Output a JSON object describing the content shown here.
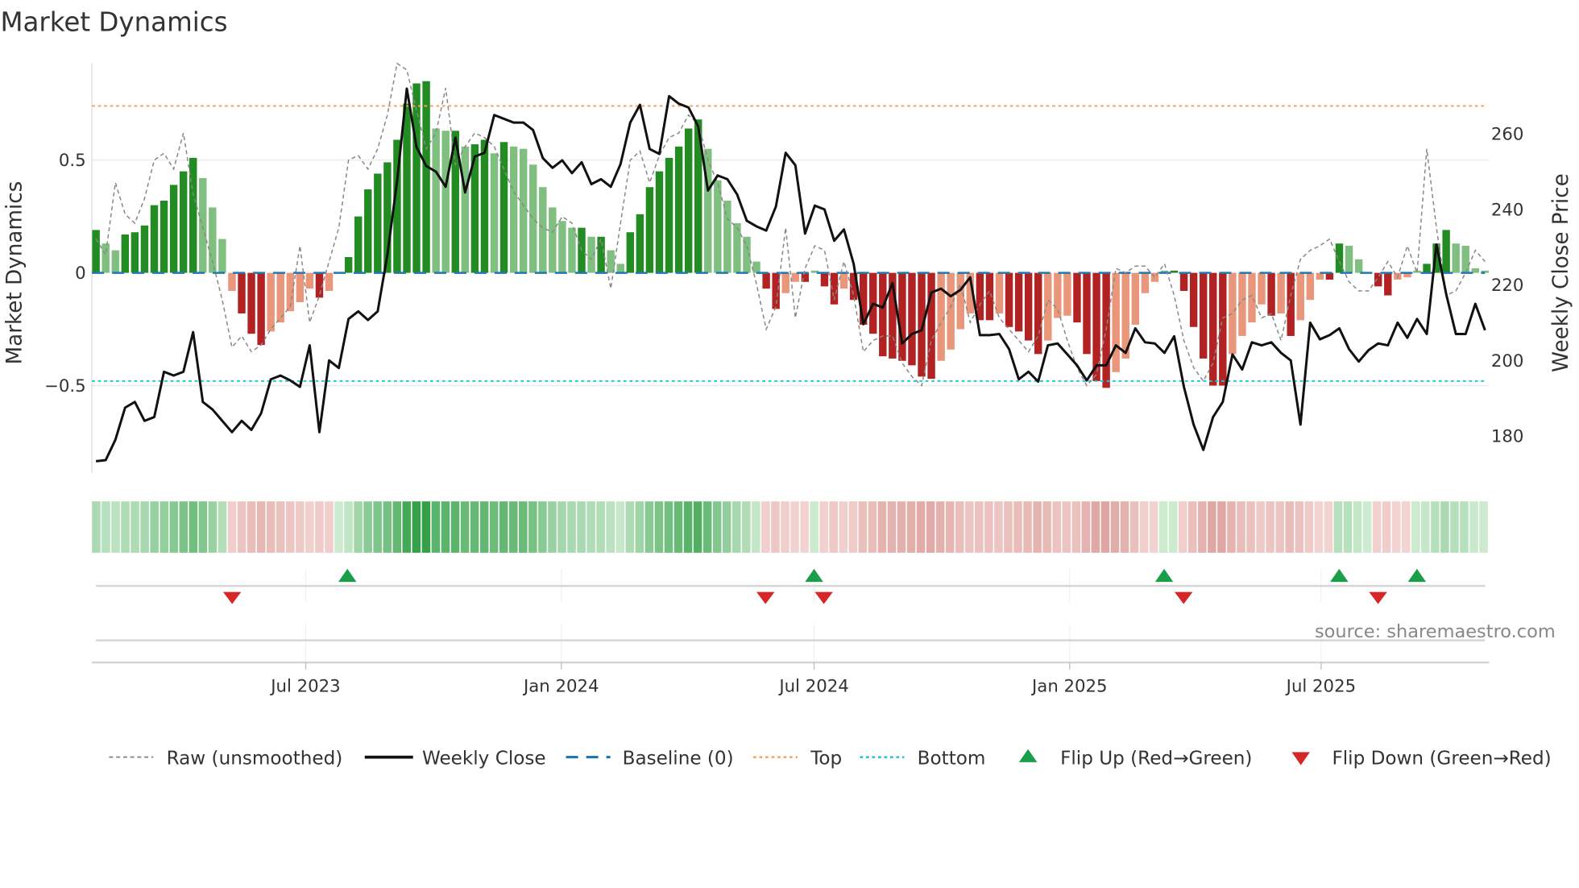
{
  "chart_data": {
    "type": "bar",
    "title": "Market Dynamics",
    "ylabel_left": "Market Dynamics",
    "ylabel_right": "Weekly Close Price",
    "ylim_left": [
      -0.92,
      0.92
    ],
    "ylim_right": [
      166,
      282
    ],
    "left_ticks": [
      {
        "v": 0.5,
        "label": "0.5"
      },
      {
        "v": 0,
        "label": "0"
      },
      {
        "v": -0.5,
        "label": "−0.5"
      }
    ],
    "right_ticks": [
      {
        "v": 260,
        "label": "260"
      },
      {
        "v": 240,
        "label": "240"
      },
      {
        "v": 220,
        "label": "220"
      },
      {
        "v": 200,
        "label": "200"
      },
      {
        "v": 180,
        "label": "180"
      }
    ],
    "x_start": "2023-01-31",
    "x_end": "2025-10-27",
    "x_ticks": [
      {
        "date": "2023-07-01",
        "label": "Jul 2023"
      },
      {
        "date": "2024-01-01",
        "label": "Jan 2024"
      },
      {
        "date": "2024-07-01",
        "label": "Jul 2024"
      },
      {
        "date": "2025-01-01",
        "label": "Jan 2025"
      },
      {
        "date": "2025-07-01",
        "label": "Jul 2025"
      }
    ],
    "top_level": 0.74,
    "bottom_level": -0.48,
    "baseline": 0,
    "momentum": [
      0.19,
      0.13,
      0.1,
      0.17,
      0.18,
      0.21,
      0.3,
      0.32,
      0.39,
      0.45,
      0.51,
      0.42,
      0.29,
      0.15,
      -0.08,
      -0.18,
      -0.27,
      -0.32,
      -0.26,
      -0.22,
      -0.17,
      -0.13,
      -0.07,
      -0.11,
      -0.08,
      0.0,
      0.07,
      0.25,
      0.37,
      0.44,
      0.49,
      0.59,
      0.75,
      0.84,
      0.85,
      0.64,
      0.63,
      0.63,
      0.56,
      0.57,
      0.59,
      0.53,
      0.58,
      0.56,
      0.55,
      0.48,
      0.38,
      0.29,
      0.23,
      0.2,
      0.2,
      0.16,
      0.16,
      0.1,
      0.04,
      0.18,
      0.26,
      0.38,
      0.45,
      0.51,
      0.56,
      0.64,
      0.68,
      0.55,
      0.41,
      0.32,
      0.22,
      0.16,
      0.05,
      -0.07,
      -0.16,
      -0.09,
      -0.04,
      -0.04,
      0.01,
      -0.06,
      -0.14,
      -0.07,
      -0.12,
      -0.23,
      -0.27,
      -0.37,
      -0.38,
      -0.39,
      -0.41,
      -0.46,
      -0.47,
      -0.39,
      -0.34,
      -0.25,
      -0.18,
      -0.21,
      -0.21,
      -0.18,
      -0.24,
      -0.26,
      -0.3,
      -0.36,
      -0.3,
      -0.2,
      -0.19,
      -0.22,
      -0.36,
      -0.48,
      -0.51,
      -0.44,
      -0.38,
      -0.23,
      -0.09,
      -0.04,
      0.01,
      0.01,
      -0.08,
      -0.24,
      -0.38,
      -0.5,
      -0.5,
      -0.36,
      -0.28,
      -0.22,
      -0.14,
      -0.19,
      -0.18,
      -0.28,
      -0.21,
      -0.12,
      -0.03,
      -0.03,
      0.13,
      0.12,
      0.06,
      0.0,
      -0.06,
      -0.1,
      -0.03,
      -0.02,
      0.01,
      0.04,
      0.13,
      0.19,
      0.13,
      0.12,
      0.02,
      0.01
    ],
    "raw": [
      0.15,
      0.08,
      0.4,
      0.26,
      0.22,
      0.33,
      0.5,
      0.53,
      0.46,
      0.62,
      0.35,
      0.2,
      0.05,
      -0.12,
      -0.33,
      -0.28,
      -0.35,
      -0.32,
      -0.25,
      -0.2,
      -0.15,
      0.12,
      -0.22,
      -0.1,
      0.05,
      0.2,
      0.5,
      0.52,
      0.46,
      0.55,
      0.7,
      0.93,
      0.9,
      0.72,
      0.55,
      0.62,
      0.82,
      0.48,
      0.56,
      0.62,
      0.6,
      0.56,
      0.46,
      0.36,
      0.3,
      0.24,
      0.2,
      0.18,
      0.25,
      0.22,
      0.1,
      0.06,
      0.15,
      -0.07,
      0.22,
      0.5,
      0.54,
      0.4,
      0.52,
      0.6,
      0.62,
      0.7,
      0.66,
      0.5,
      0.4,
      0.24,
      0.2,
      0.12,
      -0.05,
      -0.25,
      -0.15,
      0.2,
      -0.2,
      0.02,
      0.12,
      0.1,
      -0.12,
      0.05,
      -0.1,
      -0.35,
      -0.3,
      -0.28,
      -0.28,
      -0.4,
      -0.46,
      -0.5,
      -0.3,
      -0.22,
      -0.15,
      -0.05,
      -0.22,
      -0.14,
      -0.08,
      -0.2,
      -0.25,
      -0.3,
      -0.35,
      -0.28,
      -0.12,
      -0.16,
      -0.3,
      -0.42,
      -0.5,
      -0.45,
      -0.25,
      0.02,
      0.0,
      0.03,
      0.03,
      -0.02,
      0.04,
      -0.1,
      -0.3,
      -0.42,
      -0.48,
      -0.4,
      -0.2,
      -0.18,
      -0.12,
      -0.1,
      -0.2,
      -0.18,
      -0.3,
      -0.1,
      0.06,
      0.1,
      0.12,
      0.15,
      0.05,
      -0.04,
      -0.08,
      -0.08,
      -0.02,
      0.05,
      -0.02,
      0.12,
      0.0,
      0.55,
      0.2,
      -0.1,
      -0.08,
      0.0,
      0.1,
      0.05
    ],
    "weekly_close": [
      173.3,
      173.6,
      179,
      187.5,
      189,
      184,
      185,
      197,
      196,
      197,
      207.5,
      189,
      187,
      184,
      181,
      184,
      181.6,
      186,
      195,
      196,
      194.7,
      193,
      204,
      181,
      200,
      198,
      211,
      213,
      210.7,
      213,
      228,
      247.5,
      272,
      256.5,
      251.5,
      250,
      246,
      259,
      244.5,
      254,
      255,
      265,
      264,
      263,
      263,
      261,
      253.6,
      251,
      253,
      249.6,
      252.5,
      246.7,
      248,
      246,
      252,
      263,
      267.7,
      256,
      254.7,
      270,
      268,
      267,
      262,
      245,
      249,
      248,
      244,
      237,
      235.5,
      234.4,
      240.8,
      255,
      251.7,
      233.6,
      241,
      240,
      231.7,
      234.7,
      225.6,
      209.6,
      215,
      214,
      220.5,
      204.5,
      207,
      208,
      218,
      219,
      217,
      218.7,
      222,
      206.7,
      206.7,
      207,
      203,
      195,
      197,
      194.4,
      204,
      204.5,
      201.6,
      198.7,
      194.7,
      198.7,
      198.7,
      204,
      202,
      208.5,
      204.8,
      204.5,
      202,
      206.4,
      193,
      183,
      176.3,
      185,
      189,
      201.6,
      197.6,
      204.8,
      204,
      204.8,
      202,
      200,
      183,
      210,
      205.6,
      206.7,
      208.5,
      203,
      199.7,
      202.7,
      204.5,
      204,
      210,
      206,
      211,
      207,
      230.7,
      217.6,
      207,
      207,
      215,
      208
    ],
    "flip_up": [
      "2023-07-31",
      "2024-07-01",
      "2025-03-10",
      "2025-07-14",
      "2025-09-08"
    ],
    "flip_down": [
      "2023-05-09",
      "2024-05-27",
      "2024-07-08",
      "2025-03-24",
      "2025-08-11"
    ],
    "colors": {
      "strong_up": "#228b22",
      "weak_up": "#7fbf7f",
      "strong_down": "#b22222",
      "weak_down": "#e9967a",
      "baseline": "#1f77b4",
      "top": "#f4a460",
      "bottom": "#22c5d6",
      "close": "#111111",
      "raw": "#888888",
      "flip_up": "#1a9e49",
      "flip_down": "#d62728"
    },
    "legend": {
      "position": "bottom",
      "items": [
        "Raw (unsmoothed)",
        "Weekly Close",
        "Baseline (0)",
        "Top",
        "Bottom",
        "Flip Up (Red→Green)",
        "Flip Down (Green→Red)"
      ]
    },
    "source": "source: sharemaestro.com"
  }
}
